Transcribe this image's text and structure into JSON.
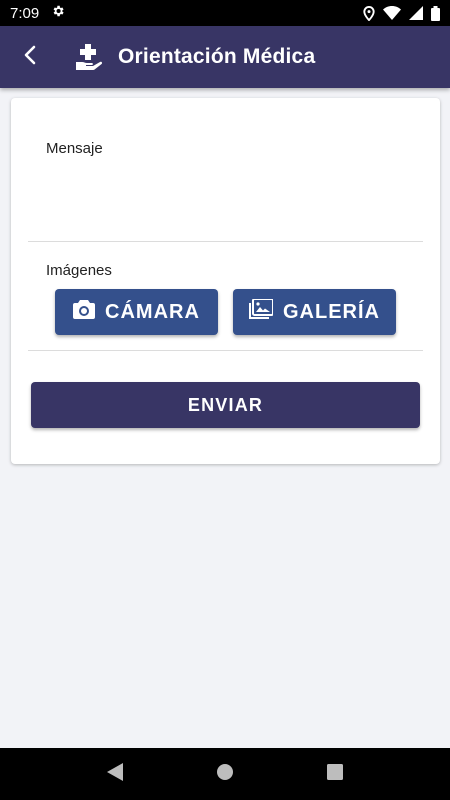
{
  "status_bar": {
    "time": "7:09",
    "icons": [
      "gear-icon",
      "location-icon",
      "wifi-icon",
      "signal-icon",
      "battery-icon"
    ]
  },
  "app_bar": {
    "title": "Orientación Médica",
    "back_icon": "chevron-left-icon",
    "title_icon": "medical-hand-icon",
    "background": "#383565"
  },
  "form": {
    "message_label": "Mensaje",
    "message_value": "",
    "images_label": "Imágenes",
    "camera_button": "CÁMARA",
    "gallery_button": "GALERÍA",
    "send_button": "ENVIAR",
    "button_color": "#34508c",
    "send_color": "#383565"
  },
  "nav_bar": {
    "icons": [
      "back-triangle-icon",
      "home-circle-icon",
      "recents-square-icon"
    ]
  }
}
